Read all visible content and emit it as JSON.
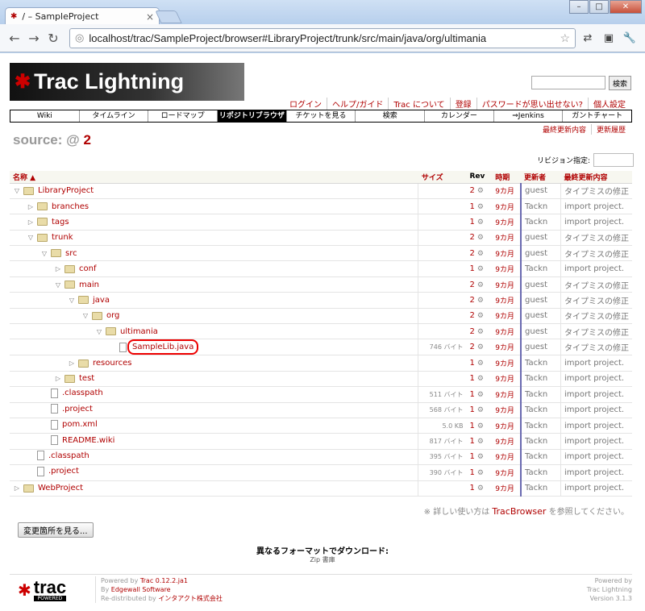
{
  "browser": {
    "tab_title": "/ – SampleProject",
    "url": "localhost/trac/SampleProject/browser#LibraryProject/trunk/src/main/java/org/ultimania"
  },
  "header": {
    "logo_text": "Trac Lightning",
    "search_button": "検索"
  },
  "metanav": [
    "ログイン",
    "ヘルプ/ガイド",
    "Trac について",
    "登録",
    "パスワードが思い出せない?",
    "個人設定"
  ],
  "mainnav": [
    {
      "label": "Wiki",
      "active": false
    },
    {
      "label": "タイムライン",
      "active": false
    },
    {
      "label": "ロードマップ",
      "active": false
    },
    {
      "label": "リポジトリブラウザ",
      "active": true
    },
    {
      "label": "チケットを見る",
      "active": false
    },
    {
      "label": "検索",
      "active": false
    },
    {
      "label": "カレンダー",
      "active": false
    },
    {
      "label": "⇒Jenkins",
      "active": false
    },
    {
      "label": "ガントチャート",
      "active": false
    }
  ],
  "ctxnav": [
    "最終更新内容",
    "更新履歴"
  ],
  "source": {
    "label": "source:",
    "at": "@",
    "rev": "2"
  },
  "rev_jump_label": "リビジョン指定:",
  "table": {
    "headers": {
      "name": "名称 ▲",
      "size": "サイズ",
      "rev": "Rev",
      "age": "時期",
      "author": "更新者",
      "change": "最終更新内容"
    },
    "rows": [
      {
        "depth": 0,
        "kind": "dir",
        "open": true,
        "name": "LibraryProject",
        "size": "",
        "rev": "2",
        "age": "9カ月",
        "author": "guest",
        "change": "タイプミスの修正"
      },
      {
        "depth": 1,
        "kind": "dir",
        "open": false,
        "name": "branches",
        "size": "",
        "rev": "1",
        "age": "9カ月",
        "author": "Tackn",
        "change": "import project."
      },
      {
        "depth": 1,
        "kind": "dir",
        "open": false,
        "name": "tags",
        "size": "",
        "rev": "1",
        "age": "9カ月",
        "author": "Tackn",
        "change": "import project."
      },
      {
        "depth": 1,
        "kind": "dir",
        "open": true,
        "name": "trunk",
        "size": "",
        "rev": "2",
        "age": "9カ月",
        "author": "guest",
        "change": "タイプミスの修正"
      },
      {
        "depth": 2,
        "kind": "dir",
        "open": true,
        "name": "src",
        "size": "",
        "rev": "2",
        "age": "9カ月",
        "author": "guest",
        "change": "タイプミスの修正"
      },
      {
        "depth": 3,
        "kind": "dir",
        "open": false,
        "name": "conf",
        "size": "",
        "rev": "1",
        "age": "9カ月",
        "author": "Tackn",
        "change": "import project."
      },
      {
        "depth": 3,
        "kind": "dir",
        "open": true,
        "name": "main",
        "size": "",
        "rev": "2",
        "age": "9カ月",
        "author": "guest",
        "change": "タイプミスの修正"
      },
      {
        "depth": 4,
        "kind": "dir",
        "open": true,
        "name": "java",
        "size": "",
        "rev": "2",
        "age": "9カ月",
        "author": "guest",
        "change": "タイプミスの修正"
      },
      {
        "depth": 5,
        "kind": "dir",
        "open": true,
        "name": "org",
        "size": "",
        "rev": "2",
        "age": "9カ月",
        "author": "guest",
        "change": "タイプミスの修正"
      },
      {
        "depth": 6,
        "kind": "dir",
        "open": true,
        "name": "ultimania",
        "size": "",
        "rev": "2",
        "age": "9カ月",
        "author": "guest",
        "change": "タイプミスの修正"
      },
      {
        "depth": 7,
        "kind": "file",
        "open": false,
        "name": "SampleLib.java",
        "size": "746 バイト",
        "rev": "2",
        "age": "9カ月",
        "author": "guest",
        "change": "タイプミスの修正",
        "highlight": true
      },
      {
        "depth": 4,
        "kind": "dir",
        "open": false,
        "name": "resources",
        "size": "",
        "rev": "1",
        "age": "9カ月",
        "author": "Tackn",
        "change": "import project."
      },
      {
        "depth": 3,
        "kind": "dir",
        "open": false,
        "name": "test",
        "size": "",
        "rev": "1",
        "age": "9カ月",
        "author": "Tackn",
        "change": "import project."
      },
      {
        "depth": 2,
        "kind": "file",
        "open": false,
        "name": ".classpath",
        "size": "511 バイト",
        "rev": "1",
        "age": "9カ月",
        "author": "Tackn",
        "change": "import project."
      },
      {
        "depth": 2,
        "kind": "file",
        "open": false,
        "name": ".project",
        "size": "568 バイト",
        "rev": "1",
        "age": "9カ月",
        "author": "Tackn",
        "change": "import project."
      },
      {
        "depth": 2,
        "kind": "file",
        "open": false,
        "name": "pom.xml",
        "size": "5.0 KB",
        "rev": "1",
        "age": "9カ月",
        "author": "Tackn",
        "change": "import project."
      },
      {
        "depth": 2,
        "kind": "file",
        "open": false,
        "name": "README.wiki",
        "size": "817 バイト",
        "rev": "1",
        "age": "9カ月",
        "author": "Tackn",
        "change": "import project."
      },
      {
        "depth": 1,
        "kind": "file",
        "open": false,
        "name": ".classpath",
        "size": "395 バイト",
        "rev": "1",
        "age": "9カ月",
        "author": "Tackn",
        "change": "import project."
      },
      {
        "depth": 1,
        "kind": "file",
        "open": false,
        "name": ".project",
        "size": "390 バイト",
        "rev": "1",
        "age": "9カ月",
        "author": "Tackn",
        "change": "import project."
      },
      {
        "depth": 0,
        "kind": "dir",
        "open": false,
        "name": "WebProject",
        "size": "",
        "rev": "1",
        "age": "9カ月",
        "author": "Tackn",
        "change": "import project."
      }
    ]
  },
  "help": {
    "prefix": "※ 詳しい使い方は",
    "link": "TracBrowser",
    "suffix": "を参照してください。"
  },
  "changes_button": "変更箇所を見る...",
  "altformat": {
    "title": "異なるフォーマットでダウンロード:",
    "links": "Zip 書庫"
  },
  "footer": {
    "logo_word": "trac",
    "logo_sub": "POWERED",
    "left_line1_prefix": "Powered by ",
    "left_line1_link": "Trac 0.12.2.ja1",
    "left_line2_prefix": "By ",
    "left_line2_link": "Edgewall Software",
    "left_line3_prefix": "Re-distributed by ",
    "left_line3_link": "インタアクト株式会社",
    "right_line1": "Powered by",
    "right_line2": "Trac Lightning",
    "right_line3": "Version 3.1.3"
  },
  "colors": {
    "link": "#b00000",
    "active_nav_bg": "#000000",
    "highlight_ring": "#e00000"
  }
}
